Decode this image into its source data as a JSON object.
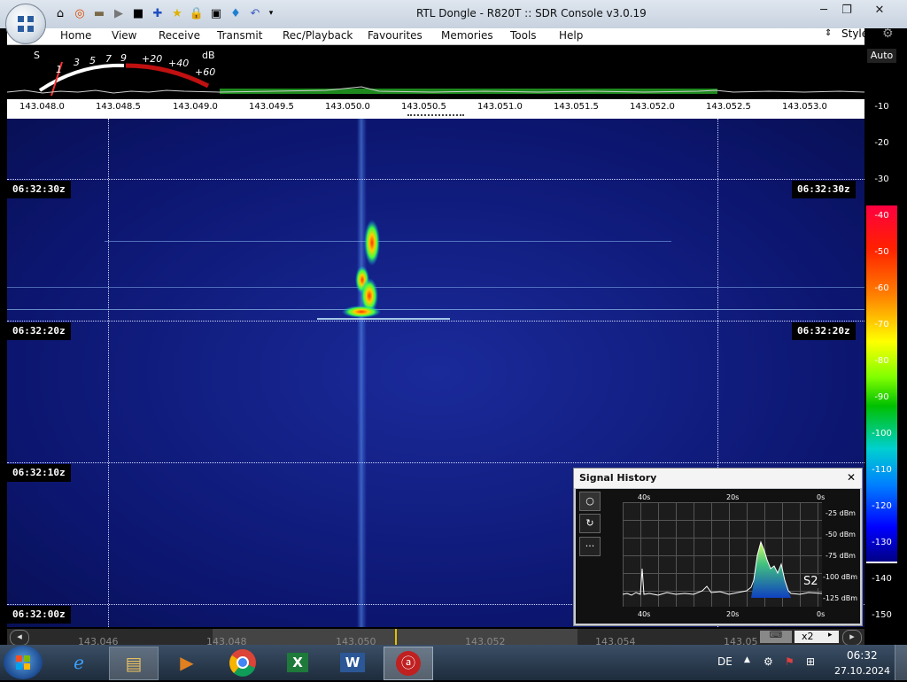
{
  "window": {
    "title": "RTL Dongle - R820T :: SDR Console v3.0.19",
    "min_label": "─",
    "max_label": "❐",
    "close_label": "✕"
  },
  "quick_access": [
    "home-icon",
    "lifebuoy-icon",
    "folder-icon",
    "play-icon",
    "stop-icon",
    "plus-icon",
    "star-icon",
    "lock-icon",
    "camera-icon",
    "drop-icon",
    "undo-icon",
    "dropdown-icon"
  ],
  "menu": {
    "items": [
      "Home",
      "View",
      "Receive",
      "Transmit",
      "Rec/Playback",
      "Favourites",
      "Memories",
      "Tools",
      "Help"
    ],
    "style_label": "Style"
  },
  "meter": {
    "s_label": "S",
    "scale": [
      "1",
      "3",
      "5",
      "7",
      "9",
      "+20",
      "+40",
      "+60"
    ],
    "db_label": "dB"
  },
  "freq_ruler": [
    "143.048.0",
    "143.048.5",
    "143.049.0",
    "143.049.5",
    "143.050.0",
    "143.050.5",
    "143.051.0",
    "143.051.5",
    "143.052.0",
    "143.052.5",
    "143.053.0"
  ],
  "waterfall": {
    "timestamps": [
      "06:32:30z",
      "06:32:20z",
      "06:32:10z",
      "06:32:00z"
    ]
  },
  "color_scale": {
    "auto_label": "Auto",
    "labels": [
      "-10",
      "-20",
      "-30",
      "-40",
      "-50",
      "-60",
      "-70",
      "-80",
      "-90",
      "-100",
      "-110",
      "-120",
      "-130",
      "-140",
      "-150"
    ]
  },
  "signal_history": {
    "title": "Signal History",
    "close": "✕",
    "top_axis": [
      "40s",
      "20s",
      "0s"
    ],
    "bottom_axis": [
      "40s",
      "20s",
      "0s"
    ],
    "y_axis": [
      "-25 dBm",
      "-50 dBm",
      "-75 dBm",
      "-100 dBm",
      "-125 dBm"
    ],
    "s_value": "S2",
    "buttons": [
      "○",
      "↻",
      "···"
    ]
  },
  "bottom_bar": {
    "freqs": [
      "143.046",
      "143.048",
      "143.050",
      "143.052",
      "143.054",
      "143.05"
    ],
    "zoom": "x2"
  },
  "taskbar": {
    "lang": "DE",
    "time": "06:32",
    "date": "27.10.2024"
  },
  "colors": {
    "waterfall_bg": "#0c1670",
    "meter_green": "#1e8a1e",
    "meter_red": "#c01010"
  }
}
